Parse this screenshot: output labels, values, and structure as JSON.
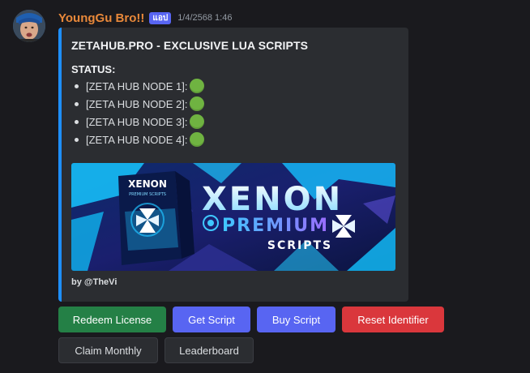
{
  "message": {
    "username": "YoungGu Bro!!",
    "badge": "แอป",
    "timestamp": "1/4/2568 1:46"
  },
  "embed": {
    "accent_color": "#1e8fff",
    "title": "ZETAHUB.PRO - EXCLUSIVE LUA SCRIPTS",
    "status_label": "STATUS:",
    "nodes": [
      {
        "label": "[ZETA HUB NODE 1]:",
        "status_color": "#6fb341"
      },
      {
        "label": "[ZETA HUB NODE 2]:",
        "status_color": "#6fb341"
      },
      {
        "label": "[ZETA HUB NODE 3]:",
        "status_color": "#6fb341"
      },
      {
        "label": "[ZETA HUB NODE 4]:",
        "status_color": "#6fb341"
      }
    ],
    "image": {
      "logo_text": "XENON",
      "line_1": "PREMIUM",
      "line_2": "SCRIPTS",
      "box_text_1": "XENON",
      "box_text_2": "PREMIUM SCRIPTS"
    },
    "footer": "by @TheVi"
  },
  "buttons": {
    "redeem": "Redeem License",
    "get_script": "Get Script",
    "buy_script": "Buy Script",
    "reset": "Reset Identifier",
    "claim": "Claim Monthly",
    "leaderboard": "Leaderboard"
  }
}
